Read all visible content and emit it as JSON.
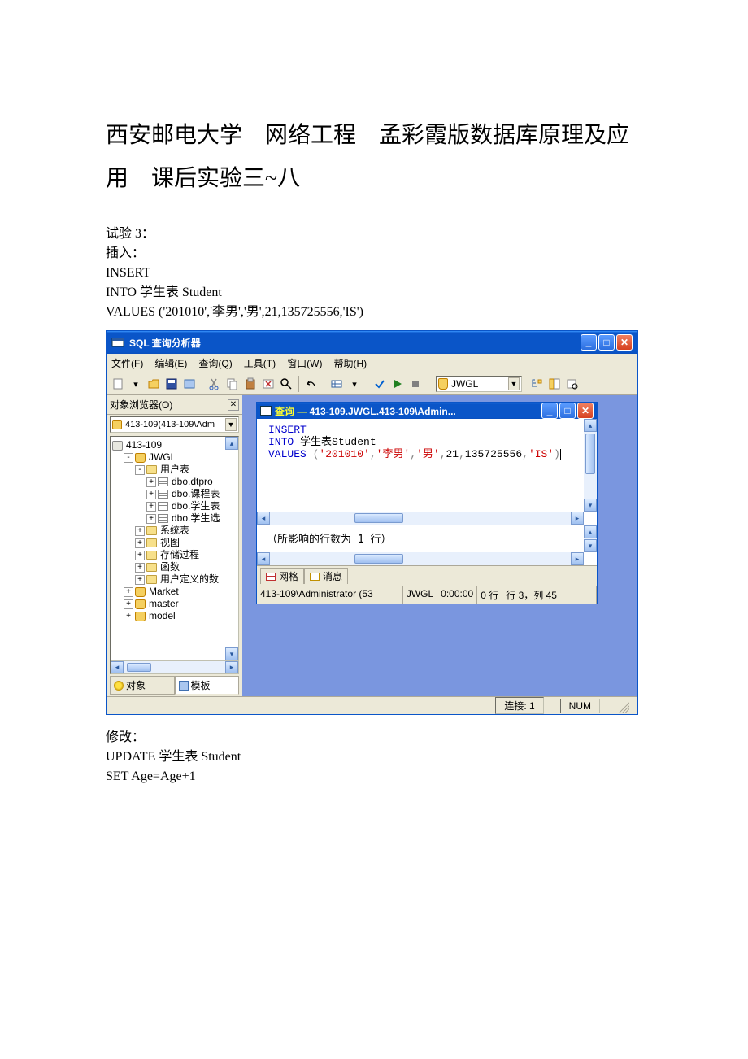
{
  "doc": {
    "title": "西安邮电大学　网络工程　孟彩霞版数据库原理及应用　课后实验三~八",
    "section_trial": "试验 3：",
    "section_insert": "插入：",
    "sql1_line1": "INSERT",
    "sql1_line2": "INTO 学生表 Student",
    "sql1_line3": "VALUES ('201010','李男','男',21,135725556,'IS')",
    "section_below1": "修改：",
    "sql2_line1": "UPDATE 学生表 Student",
    "sql2_line2": "SET Age=Age+1"
  },
  "window": {
    "title": "SQL 查询分析器"
  },
  "menus": [
    {
      "label": "文件",
      "mn": "F"
    },
    {
      "label": "编辑",
      "mn": "E"
    },
    {
      "label": "查询",
      "mn": "Q"
    },
    {
      "label": "工具",
      "mn": "T"
    },
    {
      "label": "窗口",
      "mn": "W"
    },
    {
      "label": "帮助",
      "mn": "H"
    }
  ],
  "toolbar": {
    "db": "JWGL"
  },
  "object_browser": {
    "title": "对象浏览器(O)",
    "server": "413-109(413-109\\Adm",
    "tree": {
      "server_node": "413-109",
      "db_jwgl": "JWGL",
      "user_tables": "用户表",
      "tables": [
        "dbo.dtpro",
        "dbo.课程表",
        "dbo.学生表",
        "dbo.学生选"
      ],
      "folders": [
        "系统表",
        "视图",
        "存储过程",
        "函数",
        "用户定义的数"
      ],
      "other_dbs": [
        "Market",
        "master",
        "model"
      ]
    },
    "tabs": {
      "objects": "对象",
      "templates": "模板"
    }
  },
  "query_window": {
    "title_prefix": "查询 — ",
    "title_path": "413-109.JWGL.413-109\\Admin...",
    "editor": {
      "line1": "INSERT",
      "line2_a": "INTO",
      "line2_b": " 学生表Student",
      "line3_a": "VALUES ",
      "line3_b": "(",
      "line3_c": "'201010'",
      "line3_d": ",",
      "line3_e": "'李男'",
      "line3_f": ",",
      "line3_g": "'男'",
      "line3_h": ",",
      "line3_i": "21",
      "line3_j": ",",
      "line3_k": "135725556",
      "line3_l": ",",
      "line3_m": "'IS'",
      "line3_n": ")"
    },
    "result_message": "（所影响的行数为 1 行）",
    "result_tabs": {
      "grid": "网格",
      "messages": "消息"
    },
    "status": {
      "c1": "413-109\\Administrator (53",
      "c2": "JWGL",
      "c3": "0:00:00",
      "c4": "0 行",
      "c5": "行 3，列 45"
    }
  },
  "statusbar": {
    "connections": "连接: 1",
    "num": "NUM"
  }
}
